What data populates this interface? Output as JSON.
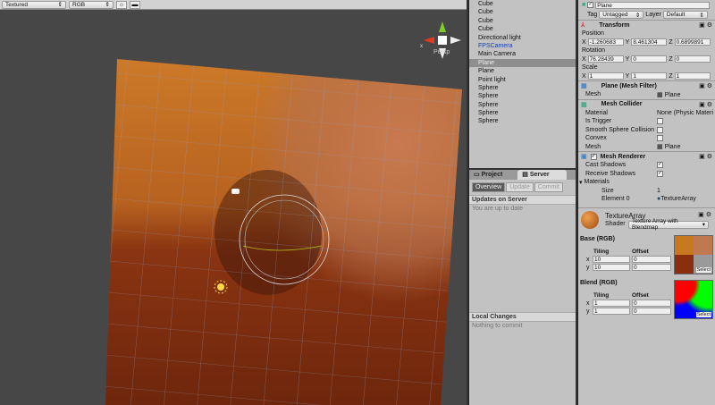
{
  "scene": {
    "draw_mode": "Textured",
    "render_mode": "RGB",
    "lighting_icon": "sun-icon",
    "image_icon": "image-icon",
    "projection": "Persp",
    "gizmo_axis": "x"
  },
  "hierarchy": {
    "items": [
      {
        "label": "Cube"
      },
      {
        "label": "Cube"
      },
      {
        "label": "Cube"
      },
      {
        "label": "Cube"
      },
      {
        "label": "Directional light"
      },
      {
        "label": "FPSCamera"
      },
      {
        "label": "Main Camera"
      },
      {
        "label": "Plane"
      },
      {
        "label": "Plane"
      },
      {
        "label": "Point light"
      },
      {
        "label": "Sphere"
      },
      {
        "label": "Sphere"
      },
      {
        "label": "Sphere"
      },
      {
        "label": "Sphere"
      },
      {
        "label": "Sphere"
      }
    ],
    "selected_index": 7
  },
  "server": {
    "tabs": [
      "Project",
      "Server"
    ],
    "active_tab": "Server",
    "segments": [
      "Overview",
      "Update",
      "Commit"
    ],
    "updates_header": "Updates on Server",
    "updates_status": "You are up to date",
    "local_header": "Local Changes",
    "local_status": "Nothing to commit"
  },
  "inspector": {
    "name": "Plane",
    "tag_label": "Tag",
    "tag": "Untagged",
    "layer_label": "Layer",
    "layer": "Default",
    "transform": {
      "title": "Transform",
      "position_label": "Position",
      "position": [
        "-1.260683",
        "8.461304",
        "0.6899891"
      ],
      "rotation_label": "Rotation",
      "rotation": [
        "76.28439",
        "0",
        "0"
      ],
      "scale_label": "Scale",
      "scale": [
        "1",
        "1",
        "1"
      ],
      "axes": [
        "X",
        "Y",
        "Z"
      ]
    },
    "mesh_filter": {
      "title": "Plane (Mesh Filter)",
      "mesh_label": "Mesh",
      "mesh": "Plane"
    },
    "mesh_collider": {
      "title": "Mesh Collider",
      "material_label": "Material",
      "material": "None (Physic Materi",
      "is_trigger_label": "Is Trigger",
      "smooth_label": "Smooth Sphere Collision",
      "convex_label": "Convex",
      "mesh_label": "Mesh",
      "mesh": "Plane"
    },
    "mesh_renderer": {
      "title": "Mesh Renderer",
      "cast_label": "Cast Shadows",
      "receive_label": "Receive Shadows",
      "materials_label": "Materials",
      "size_label": "Size",
      "size": "1",
      "element_label": "Element 0",
      "element": "TextureArray"
    },
    "material": {
      "name": "TextureArray",
      "shader_label": "Shader",
      "shader": "Texture Array with Blendmap",
      "base": {
        "label": "Base (RGB)",
        "tiling_label": "Tiling",
        "offset_label": "Offset",
        "x": "10",
        "y": "10",
        "ox": "0",
        "oy": "0",
        "select": "Select"
      },
      "blend": {
        "label": "Blend (RGB)",
        "tiling_label": "Tiling",
        "offset_label": "Offset",
        "x": "1",
        "y": "1",
        "ox": "0",
        "oy": "0",
        "select": "Select"
      },
      "x_label": "x",
      "y_label": "y"
    }
  }
}
